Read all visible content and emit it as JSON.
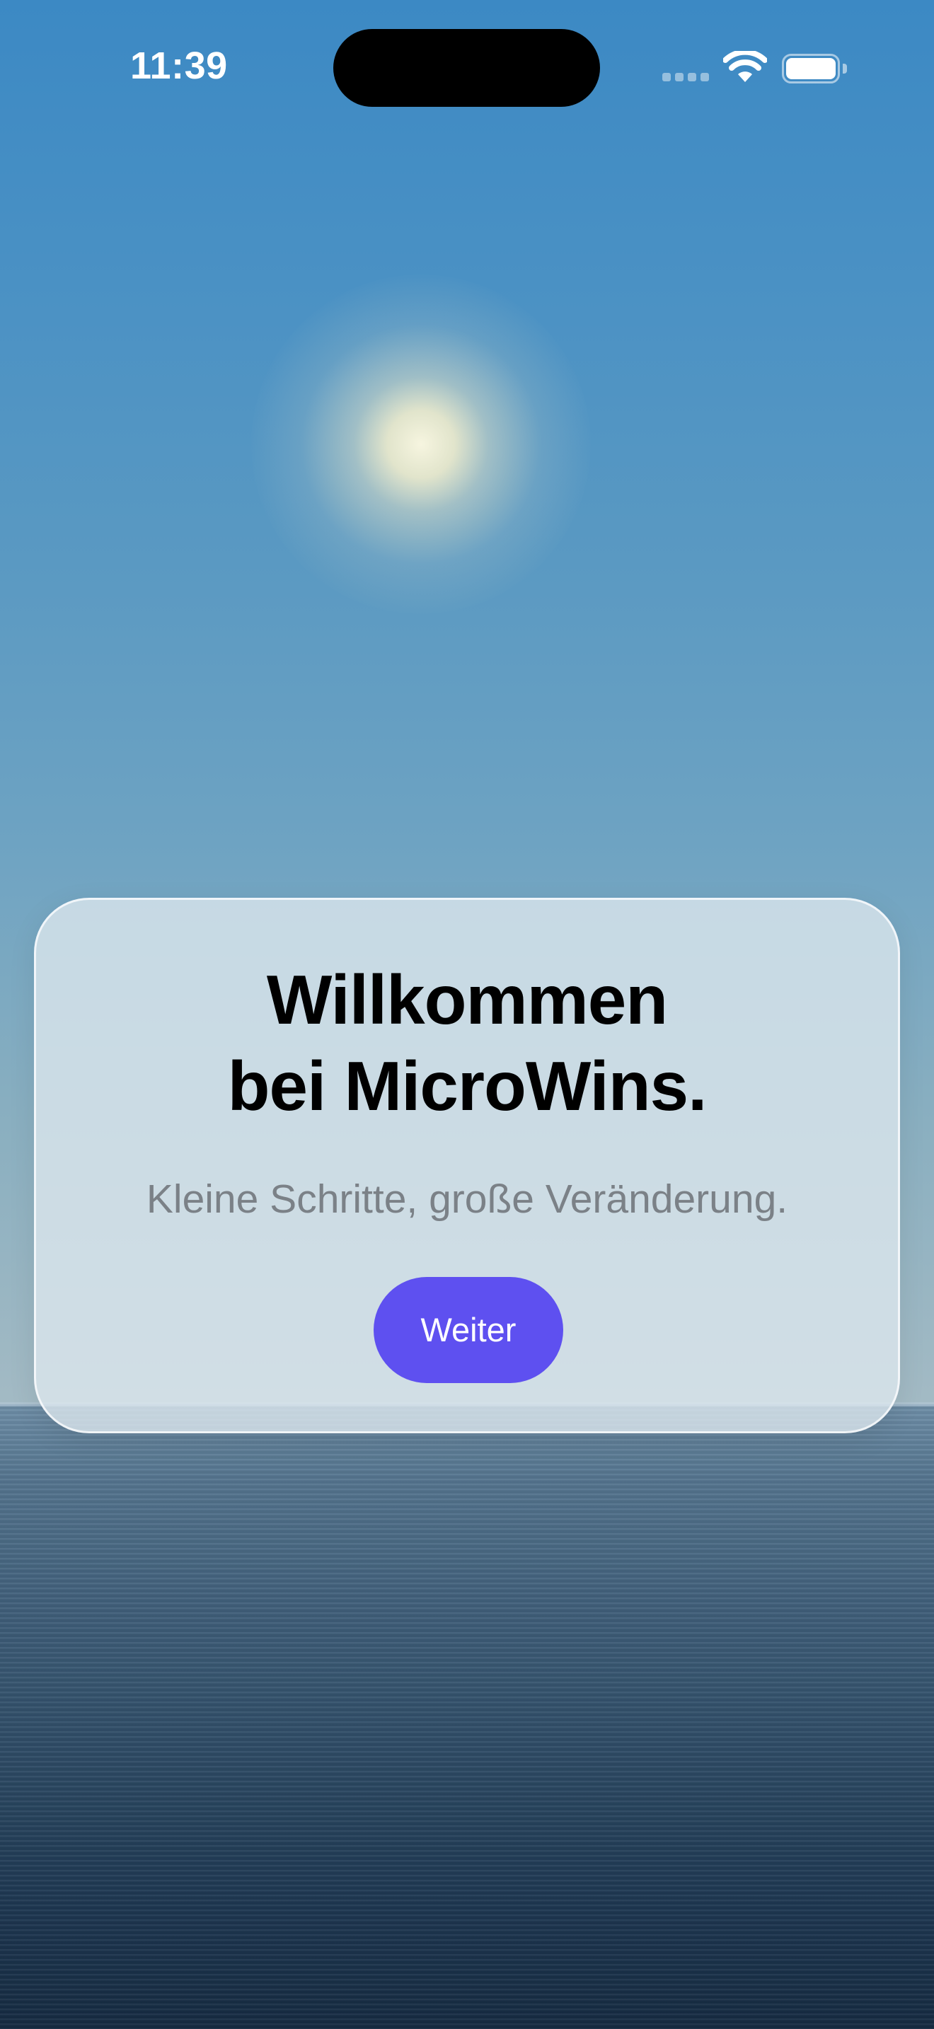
{
  "status_bar": {
    "time": "11:39"
  },
  "welcome": {
    "title_line1": "Willkommen",
    "title_line2": "bei MicroWins.",
    "subtitle": "Kleine Schritte, große Veränderung.",
    "continue_label": "Weiter"
  },
  "colors": {
    "accent": "#5e50f0",
    "sky_top": "#3c89c4",
    "sea_bottom": "#162b42"
  },
  "icons": [
    "signal-icon",
    "wifi-icon",
    "battery-icon"
  ]
}
